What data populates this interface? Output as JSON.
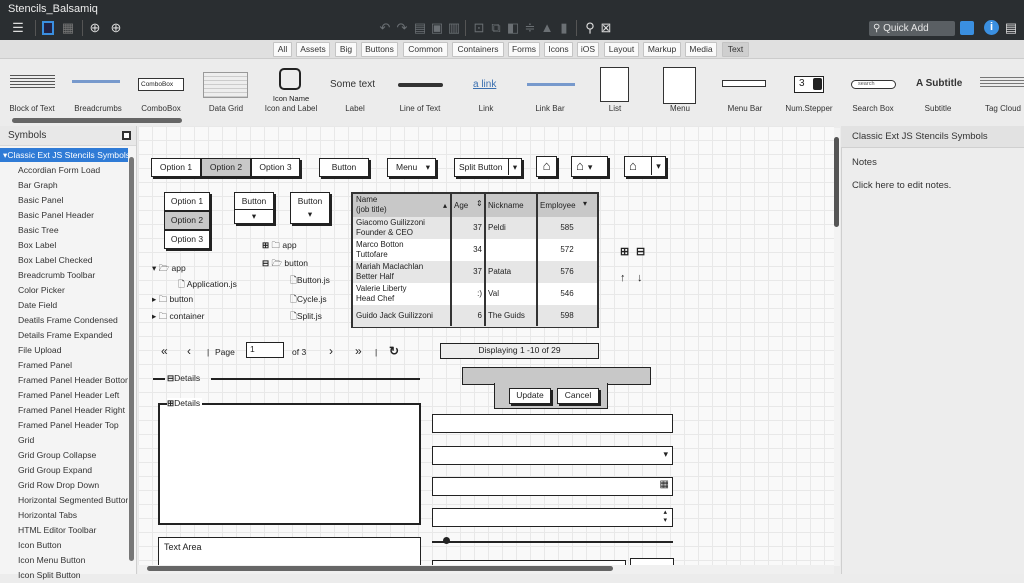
{
  "app": {
    "title": "Stencils_Balsamiq",
    "quick_add_placeholder": "Quick Add"
  },
  "toolbar": {
    "left_icons": [
      "hamburger-menu-icon",
      "single-pane-icon",
      "grid-view-icon",
      "add-mockup-icon",
      "add-asset-icon"
    ],
    "middle_icons": [
      "undo-icon",
      "redo-icon",
      "copy-icon",
      "duplicate-icon",
      "paste-icon",
      "group-icon",
      "ungroup-icon",
      "arrange-icon",
      "align-icon",
      "lock-icon",
      "delete-icon",
      "find-icon",
      "cancel-icon"
    ],
    "right_icons": [
      "presentation-icon",
      "info-icon",
      "notes-panel-icon"
    ]
  },
  "filters": [
    {
      "label": "All"
    },
    {
      "label": "Assets"
    },
    {
      "label": "Big"
    },
    {
      "label": "Buttons"
    },
    {
      "label": "Common"
    },
    {
      "label": "Containers"
    },
    {
      "label": "Forms"
    },
    {
      "label": "Icons"
    },
    {
      "label": "iOS"
    },
    {
      "label": "Layout"
    },
    {
      "label": "Markup"
    },
    {
      "label": "Media"
    },
    {
      "label": "Text",
      "active": true
    }
  ],
  "library": [
    {
      "label": "Block of Text"
    },
    {
      "label": "Breadcrumbs"
    },
    {
      "label": "ComboBox",
      "preview": "ComboBox"
    },
    {
      "label": "Data Grid"
    },
    {
      "label": "Icon and Label",
      "preview": "Icon Name"
    },
    {
      "label": "Label",
      "preview": "Some text"
    },
    {
      "label": "Line of Text"
    },
    {
      "label": "Link",
      "preview": "a link"
    },
    {
      "label": "Link Bar"
    },
    {
      "label": "List"
    },
    {
      "label": "Menu"
    },
    {
      "label": "Menu Bar"
    },
    {
      "label": "Num.Stepper",
      "preview": "3"
    },
    {
      "label": "Search Box",
      "preview": "search"
    },
    {
      "label": "Subtitle",
      "preview": "A Subtitle"
    },
    {
      "label": "Tag Cloud"
    }
  ],
  "symbols": {
    "title": "Symbols",
    "selected": "Classic Ext JS Stencils Symbols",
    "items": [
      "Accordian Form Load",
      "Bar Graph",
      "Basic Panel",
      "Basic Panel Header",
      "Basic Tree",
      "Box Label",
      "Box Label Checked",
      "Breadcrumb Toolbar",
      "Color Picker",
      "Date Field",
      "Deatils Frame Condensed",
      "Details Frame Expanded",
      "File Upload",
      "Framed Panel",
      "Framed Panel Header Bottom",
      "Framed Panel Header Left",
      "Framed Panel Header Right",
      "Framed Panel Header Top",
      "Grid",
      "Grid Group Collapse",
      "Grid Group Expand",
      "Grid Row Drop Down",
      "Horizontal Segmented Button",
      "Horizontal Tabs",
      "HTML Editor Toolbar",
      "Icon Button",
      "Icon Menu Button",
      "Icon Split Button"
    ]
  },
  "canvas": {
    "segmented": [
      "Option 1",
      "Option 2",
      "Option 3"
    ],
    "segmented_selected": 1,
    "button": "Button",
    "menu": "Menu",
    "split_button": "Split Button",
    "vertical_segmented": [
      "Option 1",
      "Option 2",
      "Option 3"
    ],
    "tree_left": [
      {
        "label": "app",
        "open": true
      },
      {
        "label": "Application.js",
        "file": true
      },
      {
        "label": "button"
      },
      {
        "label": "container"
      }
    ],
    "tree_right": [
      {
        "label": "app"
      },
      {
        "label": "button",
        "open": true
      },
      {
        "label": "Button.js"
      },
      {
        "label": "Cycle.js"
      },
      {
        "label": "Split.js"
      }
    ],
    "grid": {
      "headers": [
        "Name\n(job title)",
        "Age",
        "Nickname",
        "Employee"
      ],
      "rows": [
        {
          "name": "Giacomo Guilizzoni",
          "title": "Founder & CEO",
          "age": "37",
          "nick": "Peldi",
          "emp": "585"
        },
        {
          "name": "Marco Botton",
          "title": "Tuttofare",
          "age": "34",
          "nick": "",
          "emp": "572"
        },
        {
          "name": "Mariah Maclachlan",
          "title": "Better Half",
          "age": "37",
          "nick": "Patata",
          "emp": "576"
        },
        {
          "name": "Valerie Liberty",
          "title": "Head Chef",
          "age": ":)",
          "nick": "Val",
          "emp": "546"
        },
        {
          "name": "Guido Jack Guilizzoni",
          "title": "",
          "age": "6",
          "nick": "The Guids",
          "emp": "598"
        }
      ]
    },
    "pager": {
      "page_label": "Page",
      "page_value": "1",
      "of_label": "of 3",
      "display": "Displaying 1 -10 of 29"
    },
    "details_collapsed": "Details",
    "details_expanded": "Details",
    "update": "Update",
    "cancel": "Cancel",
    "text_area": "Text Area",
    "slider_value": 0.03
  },
  "right_panel": {
    "title": "Classic Ext JS Stencils Symbols",
    "notes_label": "Notes",
    "notes_placeholder": "Click here to edit notes."
  }
}
